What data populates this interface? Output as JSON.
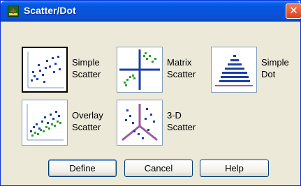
{
  "window": {
    "title": "Scatter/Dot",
    "close_label": "✕"
  },
  "options": [
    {
      "id": "simple-scatter",
      "label": "Simple\nScatter",
      "icon": "simple-scatter-icon",
      "selected": true
    },
    {
      "id": "matrix-scatter",
      "label": "Matrix\nScatter",
      "icon": "matrix-scatter-icon",
      "selected": false
    },
    {
      "id": "simple-dot",
      "label": "Simple\nDot",
      "icon": "simple-dot-icon",
      "selected": false
    },
    {
      "id": "overlay-scatter",
      "label": "Overlay\nScatter",
      "icon": "overlay-scatter-icon",
      "selected": false
    },
    {
      "id": "3d-scatter",
      "label": "3-D\nScatter",
      "icon": "3d-scatter-icon",
      "selected": false
    }
  ],
  "buttons": {
    "define": "Define",
    "cancel": "Cancel",
    "help": "Help"
  },
  "colors": {
    "title_bar": "#0a52d8",
    "dialog_bg": "#ece9d8",
    "close": "#d8431e",
    "dot_blue": "#1c3fa8",
    "dot_green": "#2e9e2e",
    "axis_purple": "#9a5aa0"
  }
}
